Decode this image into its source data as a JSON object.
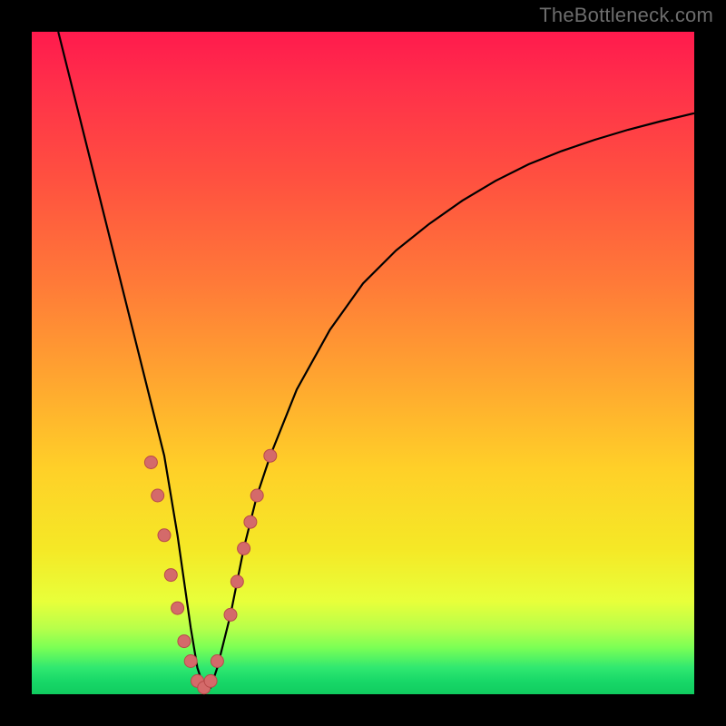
{
  "watermark": "TheBottleneck.com",
  "chart_data": {
    "type": "line",
    "title": "",
    "xlabel": "",
    "ylabel": "",
    "xlim": [
      0,
      100
    ],
    "ylim": [
      0,
      100
    ],
    "series": [
      {
        "name": "curve",
        "x": [
          4,
          6,
          8,
          10,
          12,
          14,
          16,
          18,
          20,
          22,
          24,
          25,
          26,
          27,
          28,
          30,
          32,
          34,
          36,
          40,
          45,
          50,
          55,
          60,
          65,
          70,
          75,
          80,
          85,
          90,
          95,
          100
        ],
        "y": [
          100,
          92,
          84,
          76,
          68,
          60,
          52,
          44,
          36,
          24,
          10,
          4,
          1,
          1,
          4,
          12,
          22,
          30,
          36,
          46,
          55,
          62,
          67,
          71,
          74.5,
          77.5,
          80,
          82,
          83.7,
          85.2,
          86.5,
          87.7
        ]
      },
      {
        "name": "markers",
        "x": [
          18,
          19,
          20,
          21,
          22,
          23,
          24,
          25,
          26,
          27,
          28,
          30,
          31,
          32,
          33,
          34,
          36
        ],
        "y": [
          35,
          30,
          24,
          18,
          13,
          8,
          5,
          2,
          1,
          2,
          5,
          12,
          17,
          22,
          26,
          30,
          36
        ]
      }
    ],
    "colors": {
      "curve": "#000000",
      "marker_fill": "#d46a6a",
      "marker_stroke": "#b94a4a"
    },
    "gradient_stops": [
      {
        "pos": 0,
        "color": "#ff1a4d"
      },
      {
        "pos": 50,
        "color": "#ffb030"
      },
      {
        "pos": 80,
        "color": "#f5e826"
      },
      {
        "pos": 100,
        "color": "#10cc5f"
      }
    ]
  }
}
